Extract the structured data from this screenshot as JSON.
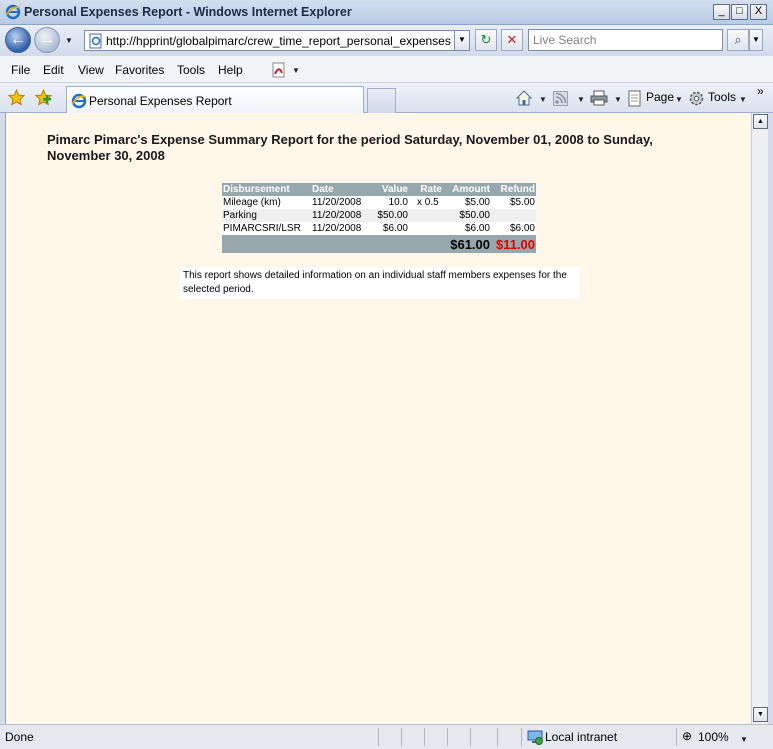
{
  "window": {
    "title": "Personal Expenses Report - Windows Internet Explorer",
    "minimize": "_",
    "maximize": "□",
    "close": "X"
  },
  "navigation": {
    "back": "←",
    "forward": "→",
    "url": "http://hpprint/globalpimarc/crew_time_report_personal_expenses_comp",
    "refresh": "↻",
    "stop": "✕",
    "search_placeholder": "Live Search",
    "search_button": "⌕"
  },
  "menu": {
    "file": "File",
    "edit": "Edit",
    "view": "View",
    "favorites": "Favorites",
    "tools": "Tools",
    "help": "Help"
  },
  "tabs": {
    "active_tab_label": "Personal Expenses Report"
  },
  "command_bar": {
    "page": "Page",
    "tools": "Tools"
  },
  "report": {
    "title": "Pimarc Pimarc's Expense Summary Report for the period Saturday, November 01, 2008 to Sunday, November 30, 2008",
    "columns": [
      "Disbursement",
      "Date",
      "Value",
      "Rate",
      "Amount",
      "Refund"
    ],
    "rows": [
      {
        "disbursement": "Mileage (km)",
        "date": "11/20/2008",
        "value": "10.0",
        "rate": "x 0.5",
        "amount": "$5.00",
        "refund": "$5.00"
      },
      {
        "disbursement": "Parking",
        "date": "11/20/2008",
        "value": "$50.00",
        "rate": "",
        "amount": "$50.00",
        "refund": ""
      },
      {
        "disbursement": "PIMARCSRI/LSR",
        "date": "11/20/2008",
        "value": "$6.00",
        "rate": "",
        "amount": "$6.00",
        "refund": "$6.00"
      }
    ],
    "total_amount": "$61.00",
    "total_refund": "$11.00",
    "note": "This report shows detailed information on an individual staff members expenses for the selected period."
  },
  "status": {
    "text": "Done",
    "zone": "Local intranet",
    "zoom": "100%"
  },
  "colors": {
    "page_background": "#fff7ea",
    "table_header": "#96a8ae",
    "refund_total": "#e00000"
  }
}
